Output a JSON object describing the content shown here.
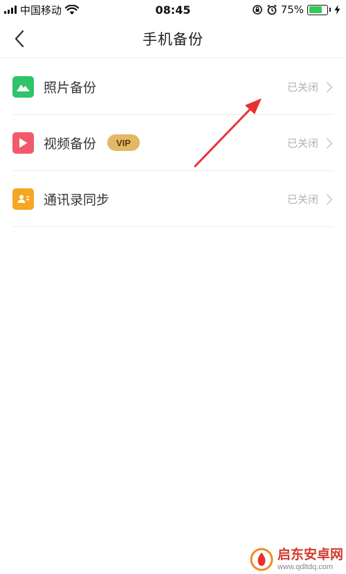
{
  "status_bar": {
    "carrier": "中国移动",
    "time": "08:45",
    "battery_percent": "75%",
    "battery_level": 0.75
  },
  "nav": {
    "title": "手机备份",
    "back_icon": "chevron-left-icon"
  },
  "items": [
    {
      "label": "照片备份",
      "status": "已关闭",
      "icon": "photo-icon",
      "icon_color": "#2fc36a"
    },
    {
      "label": "视频备份",
      "badge": "VIP",
      "status": "已关闭",
      "icon": "video-play-icon",
      "icon_color": "#f2596b"
    },
    {
      "label": "通讯录同步",
      "status": "已关闭",
      "icon": "contact-card-icon",
      "icon_color": "#f5a623"
    }
  ],
  "colors": {
    "status_text": "#b0b0b0",
    "vip_badge": "#e2b866",
    "annotation_arrow": "#e8312f"
  },
  "watermark": {
    "name": "启东安卓网",
    "url": "www.qdltdq.com"
  }
}
